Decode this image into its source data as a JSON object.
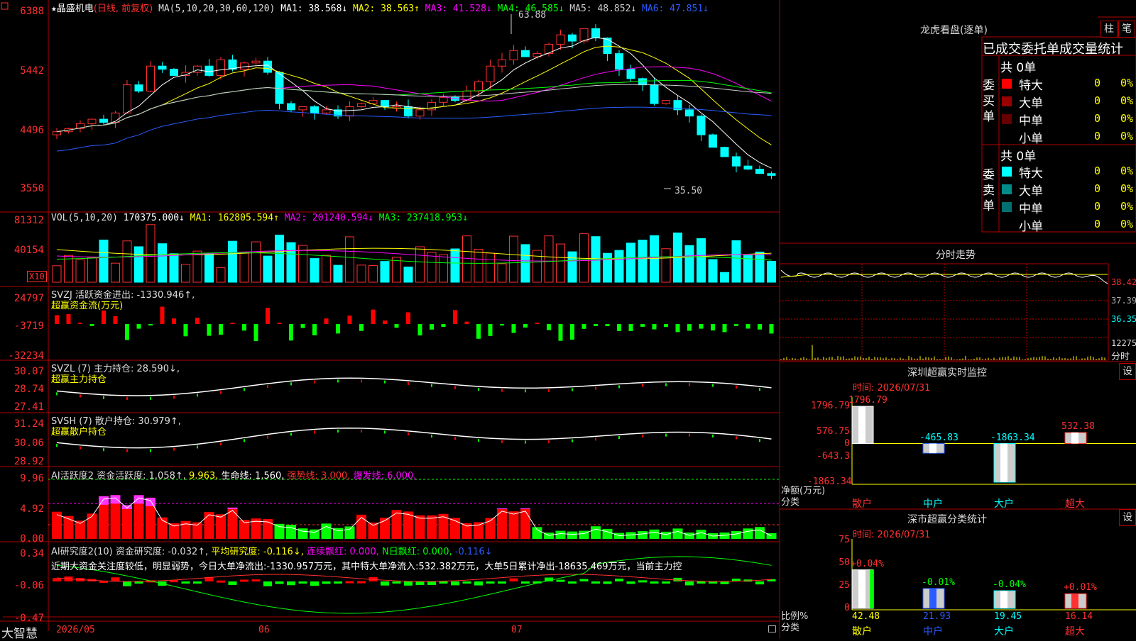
{
  "stock": {
    "name": "晶盛机电",
    "mode": "(日线, 前复权)",
    "star": "★"
  },
  "ma_bar": {
    "label": "MA(5,10,20,30,60,120)",
    "items": [
      {
        "text": "MA1: 38.568↓",
        "color": "#ffffff"
      },
      {
        "text": "MA2: 38.563↑",
        "color": "#ffff00"
      },
      {
        "text": "MA3: 41.528↓",
        "color": "#ff00ff"
      },
      {
        "text": "MA4: 46.585↓",
        "color": "#00ff00"
      },
      {
        "text": "MA5: 48.852↓",
        "color": "#cccccc"
      },
      {
        "text": "MA6: 47.851↓",
        "color": "#2a5cff"
      }
    ]
  },
  "price_axis": [
    "6388",
    "5442",
    "4496",
    "3550"
  ],
  "price_marks": {
    "high": "63.88",
    "low": "35.50"
  },
  "vol": {
    "label": "VOL(5,10,20)",
    "value": "170375.000↓",
    "items": [
      {
        "text": "MA1: 162805.594↑",
        "color": "#ffff00"
      },
      {
        "text": "MA2: 201240.594↓",
        "color": "#ff00ff"
      },
      {
        "text": "MA3: 237418.953↓",
        "color": "#00ff00"
      }
    ],
    "axis": [
      "81312",
      "40154"
    ],
    "unit": "X10"
  },
  "svzj": {
    "label": "SVZJ  活跃资金进出: -1330.946↑,",
    "sub": "超赢资金流(万元)",
    "axis": [
      "24797",
      "-3719",
      "-32234"
    ]
  },
  "svzl": {
    "label": "SVZL (7) 主力持仓: 28.590↓,",
    "sub": "超赢主力持仓",
    "axis": [
      "30.07",
      "28.74",
      "27.41"
    ]
  },
  "svsh": {
    "label": "SVSH (7) 散户持仓: 30.979↑,",
    "sub": "超赢散户持仓",
    "axis": [
      "31.24",
      "30.06",
      "28.92"
    ]
  },
  "ai": {
    "label": "AI活跃度2 资金活跃度: 1.058↑,",
    "v2": "9.963,",
    "life": "生命线: 1.560,",
    "strong": "强势线: 3.000,",
    "burst": "爆发线: 6.000,",
    "axis": [
      "9.96",
      "4.92",
      "0.00"
    ]
  },
  "research": {
    "label": "AI研究度2(10) 资金研究度: -0.032↑,",
    "avg": "平均研究度: -0.116↓,",
    "red": "连续飘红: 0.000,",
    "nred": "N日飘红: 0.000,",
    "last": "-0.116↓",
    "text": "近期大资金关注度较低，明显弱势，今日大单净流出:-1330.957万元，其中特大单净流入:532.382万元，大单5日累计净出-18635.469万元，当前主力控",
    "axis": [
      "0.34",
      "-0.06",
      "-0.47"
    ]
  },
  "footer": {
    "brand": "大智慧",
    "dates": [
      "2026/05",
      "06",
      "07"
    ]
  },
  "lhb": {
    "title": "龙虎看盘(逐单)",
    "btn1": "柱",
    "btn2": "笔",
    "header": "已成交委托单成交量统计",
    "buy": {
      "label": "委买单",
      "count": "共 0单",
      "rows": [
        {
          "name": "特大",
          "val": "0",
          "pct": "0%",
          "color": "#ff0000"
        },
        {
          "name": "大单",
          "val": "0",
          "pct": "0%",
          "color": "#990000"
        },
        {
          "name": "中单",
          "val": "0",
          "pct": "0%",
          "color": "#660000"
        },
        {
          "name": "小单",
          "val": "0",
          "pct": "0%",
          "color": "#000000"
        }
      ]
    },
    "sell": {
      "label": "委卖单",
      "count": "共 0单",
      "rows": [
        {
          "name": "特大",
          "val": "0",
          "pct": "0%",
          "color": "#00ffff"
        },
        {
          "name": "大单",
          "val": "0",
          "pct": "0%",
          "color": "#008b8b"
        },
        {
          "name": "中单",
          "val": "0",
          "pct": "0%",
          "color": "#007070"
        },
        {
          "name": "小单",
          "val": "0",
          "pct": "0%",
          "color": "#000000"
        }
      ]
    }
  },
  "fenshi": {
    "title": "分时走势",
    "axis": [
      "38.42",
      "37.39",
      "36.35"
    ],
    "vol": "12275",
    "vol_label": "分时"
  },
  "monitor": {
    "title": "深圳超赢实时监控",
    "btn": "设",
    "time": "时间: 2026/07/31",
    "axis": [
      "1796.79",
      "576.75",
      "0",
      "-643.3",
      "-1863.34"
    ],
    "ylabel": "净额(万元)",
    "xlabel": "分类",
    "cats": [
      "散户",
      "中户",
      "大户",
      "超大"
    ],
    "values": [
      "1796.79",
      "-465.83",
      "-1863.34",
      "532.38"
    ]
  },
  "classify": {
    "title": "深市超赢分类统计",
    "btn": "设",
    "time": "时间: 2026/07/31",
    "axis": [
      "75",
      "50",
      "25",
      "0"
    ],
    "ylabel": "比例%",
    "xlabel": "分类",
    "cats": [
      "散户",
      "中户",
      "大户",
      "超大"
    ],
    "values": [
      "42.48",
      "21.93",
      "19.45",
      "16.14"
    ],
    "changes": [
      "+0.04%",
      "-0.01%",
      "-0.04%",
      "+0.01%"
    ]
  },
  "chart_data": [
    {
      "type": "bar",
      "title": "深圳超赢实时监控",
      "ylabel": "净额(万元)",
      "categories": [
        "散户",
        "中户",
        "大户",
        "超大"
      ],
      "values": [
        1796.79,
        -465.83,
        -1863.34,
        532.38
      ],
      "ylim": [
        -1863.34,
        1796.79
      ]
    },
    {
      "type": "bar",
      "title": "深市超赢分类统计",
      "ylabel": "比例%",
      "categories": [
        "散户",
        "中户",
        "大户",
        "超大"
      ],
      "values": [
        42.48,
        21.93,
        19.45,
        16.14
      ],
      "ylim": [
        0,
        75
      ]
    }
  ]
}
